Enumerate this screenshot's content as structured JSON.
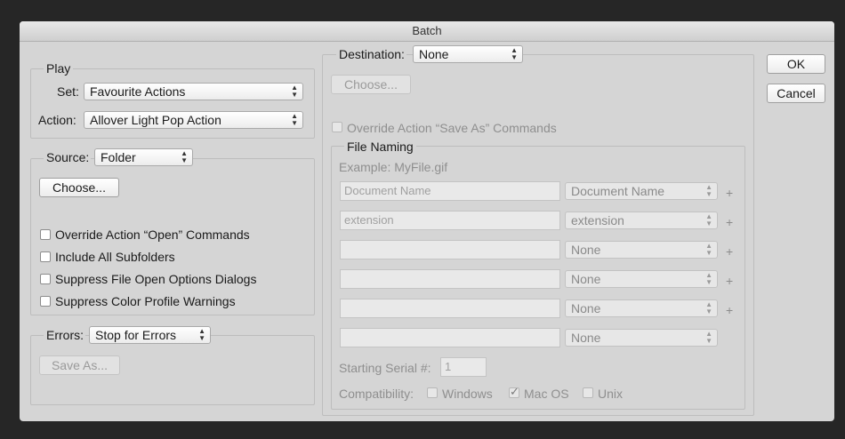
{
  "window": {
    "title": "Batch"
  },
  "play": {
    "legend": "Play",
    "set_label": "Set:",
    "set_value": "Favourite Actions",
    "action_label": "Action:",
    "action_value": "Allover Light Pop Action"
  },
  "source": {
    "label": "Source:",
    "value": "Folder",
    "choose_label": "Choose...",
    "checkboxes": [
      {
        "label": "Override Action “Open” Commands",
        "checked": false
      },
      {
        "label": "Include All Subfolders",
        "checked": false
      },
      {
        "label": "Suppress File Open Options Dialogs",
        "checked": false
      },
      {
        "label": "Suppress Color Profile Warnings",
        "checked": false
      }
    ]
  },
  "errors": {
    "label": "Errors:",
    "value": "Stop for Errors",
    "save_as_label": "Save As..."
  },
  "destination": {
    "label": "Destination:",
    "value": "None",
    "choose_label": "Choose...",
    "override_label": "Override Action “Save As” Commands"
  },
  "file_naming": {
    "legend": "File Naming",
    "example": "Example: MyFile.gif",
    "rows": [
      {
        "field": "Document Name",
        "select": "Document Name",
        "plus": "+"
      },
      {
        "field": "extension",
        "select": "extension",
        "plus": "+"
      },
      {
        "field": "",
        "select": "None",
        "plus": "+"
      },
      {
        "field": "",
        "select": "None",
        "plus": "+"
      },
      {
        "field": "",
        "select": "None",
        "plus": "+"
      },
      {
        "field": "",
        "select": "None",
        "plus": ""
      }
    ],
    "serial_label": "Starting Serial #:",
    "serial_value": "1",
    "compat_label": "Compatibility:",
    "compat": [
      {
        "label": "Windows",
        "checked": false
      },
      {
        "label": "Mac OS",
        "checked": true
      },
      {
        "label": "Unix",
        "checked": false
      }
    ]
  },
  "buttons": {
    "ok": "OK",
    "cancel": "Cancel"
  }
}
